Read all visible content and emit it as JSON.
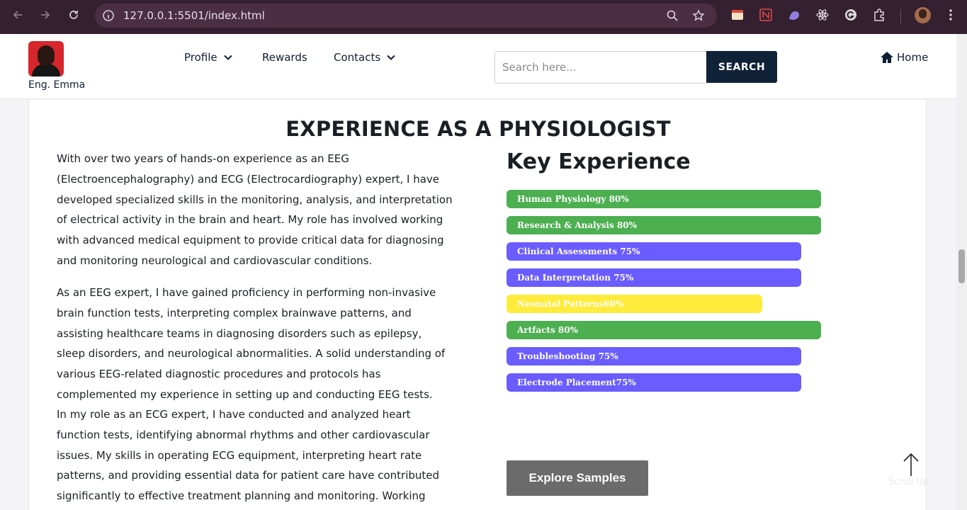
{
  "browser": {
    "url": "127.0.0.1:5501/index.html",
    "back_icon": "arrow-left-icon",
    "forward_icon": "arrow-right-icon",
    "reload_icon": "reload-icon"
  },
  "header": {
    "brand_name": "Eng. Emma",
    "menu": [
      {
        "label": "Profile",
        "has_dropdown": true
      },
      {
        "label": "Rewards",
        "has_dropdown": false
      },
      {
        "label": "Contacts",
        "has_dropdown": true
      }
    ],
    "search": {
      "placeholder": "Search here...",
      "button_label": "SEARCH"
    },
    "home_label": "Home"
  },
  "section": {
    "title": "EXPERIENCE AS A PHYSIOLOGIST",
    "paragraph_1": "With over two years of hands-on experience as an EEG (Electroencephalography) and ECG (Electrocardiography) expert, I have developed specialized skills in the monitoring, analysis, and interpretation of electrical activity in the brain and heart. My role has involved working with advanced medical equipment to provide critical data for diagnosing and monitoring neurological and cardiovascular conditions.",
    "paragraph_2": "As an EEG expert, I have gained proficiency in performing non-invasive brain function tests, interpreting complex brainwave patterns, and assisting healthcare teams in diagnosing disorders such as epilepsy, sleep disorders, and neurological abnormalities. A solid understanding of various EEG-related diagnostic procedures and protocols has complemented my experience in setting up and conducting EEG tests.",
    "paragraph_3": "In my role as an ECG expert, I have conducted and analyzed heart function tests, identifying abnormal rhythms and other cardiovascular issues. My skills in operating ECG equipment, interpreting heart rate patterns, and providing essential data for patient care have contributed significantly to effective treatment planning and monitoring. Working closely with",
    "key_title": "Key Experience",
    "skills": [
      {
        "label": "Human Physiology 80%",
        "percent": 80,
        "color": "#4caf50"
      },
      {
        "label": "Research & Analysis 80%",
        "percent": 80,
        "color": "#4caf50"
      },
      {
        "label": "Clinical Assessments 75%",
        "percent": 75,
        "color": "#6a5cff"
      },
      {
        "label": "Data Interpretation 75%",
        "percent": 75,
        "color": "#6a5cff"
      },
      {
        "label": "Neonatal Patterns60%",
        "percent": 65,
        "color": "#ffeb3b"
      },
      {
        "label": "Artfacts 80%",
        "percent": 80,
        "color": "#4caf50"
      },
      {
        "label": "Troubleshooting 75%",
        "percent": 75,
        "color": "#6a5cff"
      },
      {
        "label": "Electrode Placement75%",
        "percent": 75,
        "color": "#6a5cff"
      }
    ],
    "explore_label": "Explore Samples",
    "scroll_up_label": "Scroll Up"
  }
}
